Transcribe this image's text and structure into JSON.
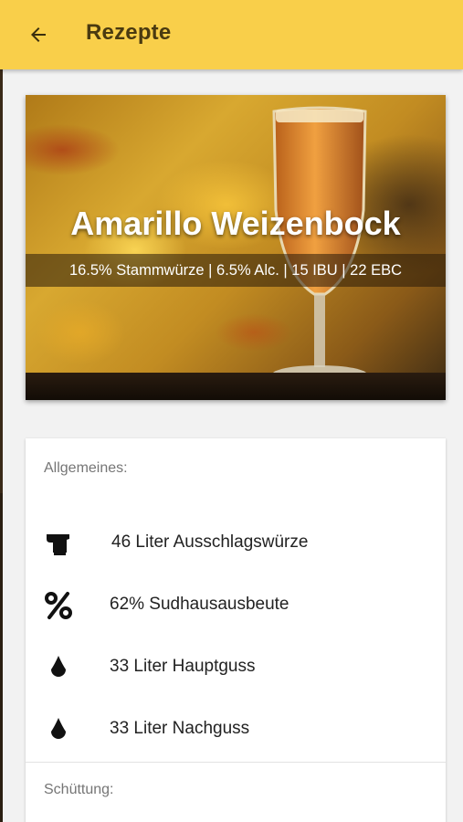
{
  "appbar": {
    "title": "Rezepte",
    "background": "#f9cf4a"
  },
  "hero": {
    "recipe_name": "Amarillo Weizenbock",
    "stats": "16.5% Stammwürze | 6.5% Alc. | 15 IBU | 22 EBC"
  },
  "general": {
    "section_label": "Allgemeines:",
    "items": [
      {
        "icon": "kettle-icon",
        "text": "46 Liter Ausschlagswürze"
      },
      {
        "icon": "percent-icon",
        "text": "62% Sudhausausbeute"
      },
      {
        "icon": "water-drop-icon",
        "text": "33 Liter Hauptguss"
      },
      {
        "icon": "water-drop-icon",
        "text": "33 Liter Nachguss"
      }
    ]
  },
  "grain": {
    "section_label": "Schüttung:"
  }
}
